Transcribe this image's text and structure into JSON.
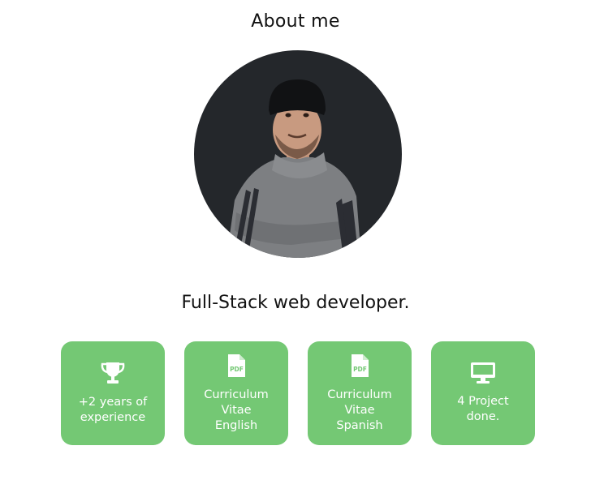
{
  "header": {
    "title": "About me"
  },
  "profile": {
    "headline": "Full-Stack web developer."
  },
  "colors": {
    "card_bg": "#74c874",
    "avatar_bg": "#24272b"
  },
  "cards": [
    {
      "icon": "trophy-icon",
      "lines": [
        "+2 years of",
        "experience"
      ]
    },
    {
      "icon": "pdf-icon",
      "lines": [
        "Curriculum",
        "Vitae",
        "English"
      ]
    },
    {
      "icon": "pdf-icon",
      "lines": [
        "Curriculum",
        "Vitae",
        "Spanish"
      ]
    },
    {
      "icon": "monitor-icon",
      "lines": [
        "4 Project",
        "done."
      ]
    }
  ]
}
